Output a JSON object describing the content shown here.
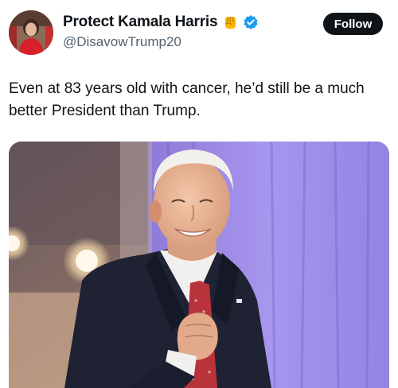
{
  "post": {
    "author": {
      "display_name": "Protect Kamala Harris",
      "handle": "@DisavowTrump20",
      "emoji_icon": "raised-fist-emoji",
      "verified_icon": "verified-badge-icon",
      "verified_color": "#1d9bf0"
    },
    "follow_button": {
      "label": "Follow"
    },
    "text": "Even at 83 years old with cancer, he’d still be a much better President than Trump.",
    "media": {
      "type": "photo"
    }
  }
}
